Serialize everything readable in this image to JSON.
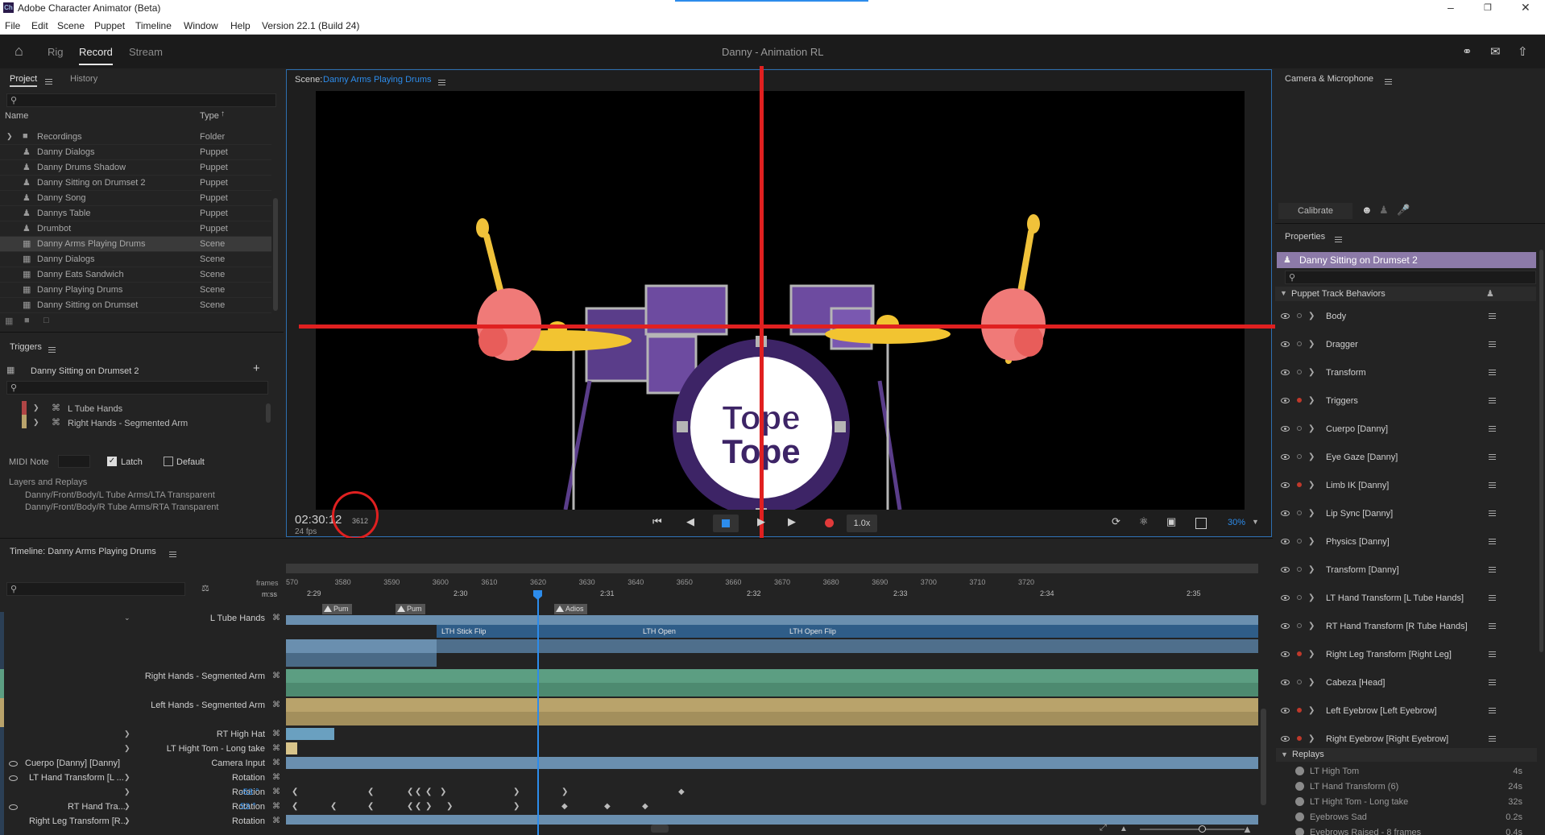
{
  "app": {
    "title": "Adobe Character Animator (Beta)",
    "logo": "Ch",
    "version": "Version 22.1 (Build 24)",
    "document_title": "Danny - Animation RL"
  },
  "menu": [
    "File",
    "Edit",
    "Scene",
    "Puppet",
    "Timeline",
    "Window",
    "Help"
  ],
  "modes": {
    "rig": "Rig",
    "record": "Record",
    "stream": "Stream"
  },
  "project": {
    "tab_project": "Project",
    "tab_history": "History",
    "col_name": "Name",
    "col_type": "Type",
    "items": [
      {
        "name": "Recordings",
        "type": "Folder",
        "icon": "folder-icon"
      },
      {
        "name": "Danny Dialogs",
        "type": "Puppet",
        "icon": "puppet-icon"
      },
      {
        "name": "Danny Drums Shadow",
        "type": "Puppet",
        "icon": "puppet-icon"
      },
      {
        "name": "Danny Sitting on Drumset 2",
        "type": "Puppet",
        "icon": "puppet-icon"
      },
      {
        "name": "Danny Song",
        "type": "Puppet",
        "icon": "puppet-icon"
      },
      {
        "name": "Dannys Table",
        "type": "Puppet",
        "icon": "puppet-icon"
      },
      {
        "name": "Drumbot",
        "type": "Puppet",
        "icon": "puppet-icon"
      },
      {
        "name": "Danny Arms Playing Drums",
        "type": "Scene",
        "icon": "scene-icon"
      },
      {
        "name": "Danny Dialogs",
        "type": "Scene",
        "icon": "scene-icon"
      },
      {
        "name": "Danny Eats Sandwich",
        "type": "Scene",
        "icon": "scene-icon"
      },
      {
        "name": "Danny Playing Drums",
        "type": "Scene",
        "icon": "scene-icon"
      },
      {
        "name": "Danny Sitting on Drumset",
        "type": "Scene",
        "icon": "scene-icon"
      }
    ]
  },
  "triggers": {
    "title": "Triggers",
    "puppet": "Danny Sitting on Drumset 2",
    "items": [
      "L Tube Hands",
      "Right Hands - Segmented Arm"
    ],
    "midi_label": "MIDI Note",
    "latch": "Latch",
    "default": "Default",
    "layers_title": "Layers and Replays",
    "layers": [
      "Danny/Front/Body/L Tube Arms/LTA Transparent",
      "Danny/Front/Body/R Tube Arms/RTA Transparent"
    ]
  },
  "scene": {
    "label": "Scene:",
    "name": "Danny Arms Playing Drums",
    "timecode": "02:30:12",
    "frame": "3612",
    "fps": "24 fps",
    "speed": "1.0x",
    "zoom": "30%",
    "logo_line1": "Tope",
    "logo_line2": "Tope"
  },
  "camera": {
    "title": "Camera & Microphone",
    "calibrate": "Calibrate"
  },
  "properties": {
    "title": "Properties",
    "puppet": "Danny Sitting on Drumset 2",
    "section": "Puppet Track Behaviors",
    "behaviors": [
      {
        "name": "Body",
        "armed": false
      },
      {
        "name": "Dragger",
        "armed": false
      },
      {
        "name": "Transform",
        "armed": false
      },
      {
        "name": "Triggers",
        "armed": true
      },
      {
        "name": "Cuerpo [Danny]",
        "armed": false
      },
      {
        "name": "Eye Gaze [Danny]",
        "armed": false
      },
      {
        "name": "Limb IK [Danny]",
        "armed": true
      },
      {
        "name": "Lip Sync [Danny]",
        "armed": false
      },
      {
        "name": "Physics [Danny]",
        "armed": false
      },
      {
        "name": "Transform [Danny]",
        "armed": false
      },
      {
        "name": "LT Hand Transform [L Tube Hands]",
        "armed": false
      },
      {
        "name": "RT Hand Transform [R Tube Hands]",
        "armed": false
      },
      {
        "name": "Right Leg Transform [Right Leg]",
        "armed": true
      },
      {
        "name": "Cabeza [Head]",
        "armed": false
      },
      {
        "name": "Left Eyebrow [Left Eyebrow]",
        "armed": true
      },
      {
        "name": "Right Eyebrow [Right Eyebrow]",
        "armed": true
      }
    ],
    "replays_title": "Replays",
    "replays": [
      {
        "name": "LT High Tom",
        "duration": "4s"
      },
      {
        "name": "LT Hand Transform (6)",
        "duration": "24s"
      },
      {
        "name": "LT Hight Tom - Long take",
        "duration": "32s"
      },
      {
        "name": "Eyebrows Sad",
        "duration": "0.2s"
      },
      {
        "name": "Eyebrows Raised - 8 frames",
        "duration": "0.4s"
      }
    ]
  },
  "timeline": {
    "title": "Timeline: Danny Arms Playing Drums",
    "frames_label": "frames",
    "mss_label": "m:ss",
    "frame_ticks": [
      "570",
      "3580",
      "3590",
      "3600",
      "3610",
      "3620",
      "3630",
      "3640",
      "3650",
      "3660",
      "3670",
      "3680",
      "3690",
      "3700",
      "3710",
      "3720"
    ],
    "time_ticks": [
      "2:29",
      "2:30",
      "2:31",
      "2:32",
      "2:33",
      "2:34",
      "2:35"
    ],
    "markers": [
      "Pum",
      "Pum",
      "Adios"
    ],
    "clips": [
      "LTH Stick Flip",
      "LTH Open",
      "LTH Open Flip"
    ],
    "rows": [
      {
        "label": "L Tube Hands"
      },
      {
        "label": "Right Hands - Segmented Arm"
      },
      {
        "label": "Left Hands - Segmented Arm"
      },
      {
        "label": "RT High Hat"
      },
      {
        "label": "LT Hight Tom - Long take"
      },
      {
        "label": "Camera Input",
        "track": "Cuerpo [Danny] [Danny]"
      },
      {
        "label": "Rotation",
        "track": "LT Hand Transform [L ..."
      },
      {
        "label": "Rotation",
        "value": "-53 °"
      },
      {
        "label": "Rotation",
        "track": "RT Hand Tra...",
        "value": "53 °"
      },
      {
        "label": "Rotation",
        "track": "Right Leg Transform [R..."
      }
    ]
  },
  "colors": {
    "accent": "#2d8ceb",
    "red_guide": "#e02020",
    "record": "#e03a3a",
    "green_track": "#5c9e82",
    "gold_track": "#b9a36b",
    "blue_track": "#6a8faf"
  }
}
